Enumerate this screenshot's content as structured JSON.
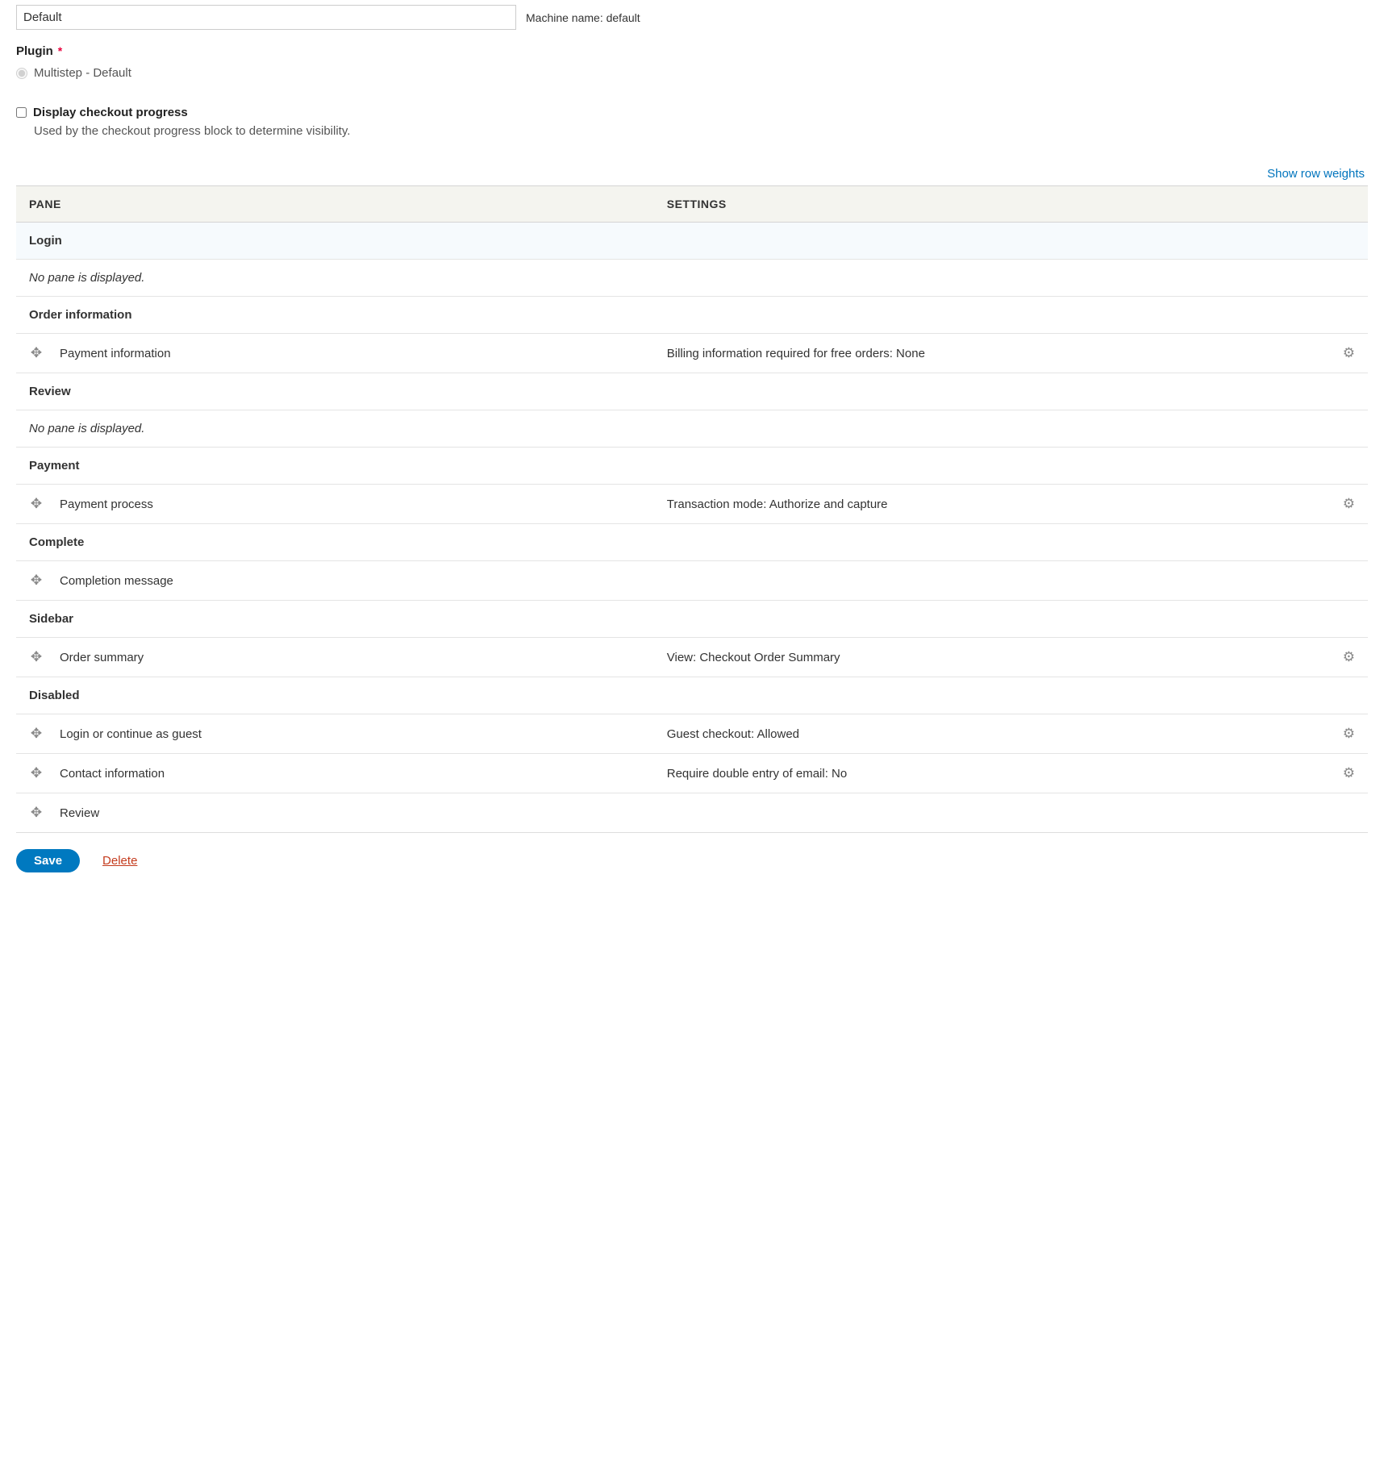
{
  "name_field": {
    "value": "Default"
  },
  "machine_name": {
    "label": "Machine name:",
    "value": "default"
  },
  "plugin": {
    "label": "Plugin",
    "required": "*",
    "option": "Multistep - Default"
  },
  "display_progress": {
    "label": "Display checkout progress",
    "help": "Used by the checkout progress block to determine visibility."
  },
  "show_weights": "Show row weights",
  "table": {
    "headers": {
      "pane": "PANE",
      "settings": "SETTINGS"
    },
    "rows": [
      {
        "type": "region",
        "label": "Login",
        "highlight": true
      },
      {
        "type": "empty",
        "label": "No pane is displayed."
      },
      {
        "type": "region",
        "label": "Order information"
      },
      {
        "type": "pane",
        "label": "Payment information",
        "settings": "Billing information required for free orders: None",
        "gear": true
      },
      {
        "type": "region",
        "label": "Review"
      },
      {
        "type": "empty",
        "label": "No pane is displayed."
      },
      {
        "type": "region",
        "label": "Payment"
      },
      {
        "type": "pane",
        "label": "Payment process",
        "settings": "Transaction mode: Authorize and capture",
        "gear": true
      },
      {
        "type": "region",
        "label": "Complete"
      },
      {
        "type": "pane",
        "label": "Completion message",
        "settings": "",
        "gear": false
      },
      {
        "type": "region",
        "label": "Sidebar"
      },
      {
        "type": "pane",
        "label": "Order summary",
        "settings": "View: Checkout Order Summary",
        "gear": true
      },
      {
        "type": "region",
        "label": "Disabled"
      },
      {
        "type": "pane",
        "label": "Login or continue as guest",
        "settings": "Guest checkout: Allowed",
        "gear": true
      },
      {
        "type": "pane",
        "label": "Contact information",
        "settings": "Require double entry of email: No",
        "gear": true
      },
      {
        "type": "pane",
        "label": "Review",
        "settings": "",
        "gear": false
      }
    ]
  },
  "actions": {
    "save": "Save",
    "delete": "Delete"
  }
}
